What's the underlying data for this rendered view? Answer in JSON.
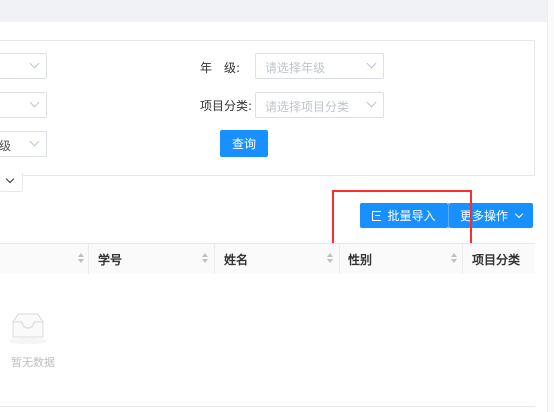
{
  "filters": {
    "grade_label": "年　级:",
    "grade_placeholder": "请选择年级",
    "category_label": "项目分类:",
    "category_placeholder": "请选择项目分类",
    "partial_select_text": "级",
    "query_button": "查询"
  },
  "toolbar": {
    "batch_import": "批量导入",
    "more_actions": "更多操作"
  },
  "table": {
    "columns": [
      "学号",
      "姓名",
      "性别",
      "项目分类"
    ],
    "empty_text": "暂无数据"
  },
  "colors": {
    "primary": "#1890ff",
    "highlight": "#ff2a2a"
  }
}
